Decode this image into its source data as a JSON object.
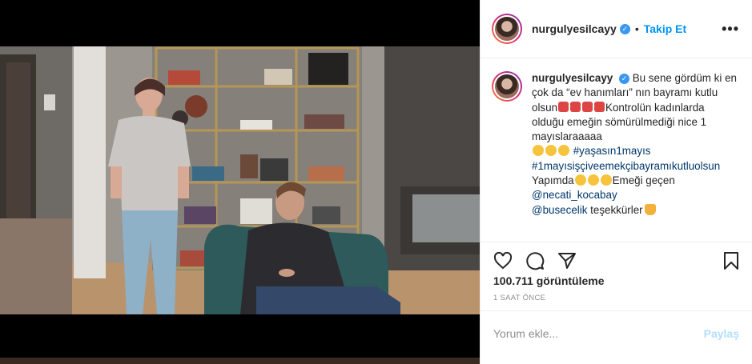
{
  "post": {
    "username": "nurgulyesilcayy",
    "follow_label": "Takip Et",
    "more_label": "•••",
    "caption": {
      "line1": "Bu sene gördüm ki en çok da “ev hanımları” nın bayramı kutlu olsun",
      "line2": "Kontrolün kadınlarda olduğu emeğin sömürülmediği nice 1 mayıslaraaaaa",
      "hashtag1": "#yaşasın1mayıs",
      "hashtag2": "#1mayısişçiveemekçibayramıkutluolsun",
      "credits_prefix": "Yapımda",
      "credits_suffix": "Emeği geçen",
      "mention1": "@necati_kocabay",
      "mention2": "@busecelik",
      "thanks": "teşekkürler"
    },
    "views": "100.711 görüntüleme",
    "time_ago": "1 SAAT ÖNCE",
    "comment_placeholder": "Yorum ekle...",
    "share_label": "Paylaş"
  },
  "icons": {
    "like": "heart-icon",
    "comment": "comment-icon",
    "share": "paper-plane-icon",
    "save": "bookmark-icon",
    "verified": "verified-badge-icon"
  },
  "colors": {
    "link": "#0095f6",
    "mention": "#00376b",
    "muted": "#8e8e8e",
    "share_disabled": "#b2dffc"
  }
}
